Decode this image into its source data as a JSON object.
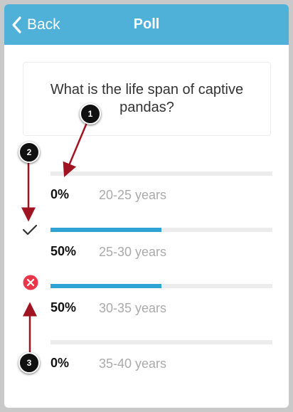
{
  "navbar": {
    "back_label": "Back",
    "title": "Poll",
    "color": "#4fb0d8"
  },
  "question": "What is the life span of captive pandas?",
  "options": [
    {
      "percent_label": "0%",
      "answer": "20-25 years",
      "fraction": 0.0,
      "state": "none"
    },
    {
      "percent_label": "50%",
      "answer": "25-30 years",
      "fraction": 0.5,
      "state": "correct",
      "icon": "checkmark-icon"
    },
    {
      "percent_label": "50%",
      "answer": "30-35 years",
      "fraction": 0.5,
      "state": "incorrect",
      "icon": "x-circle-icon"
    },
    {
      "percent_label": "0%",
      "answer": "35-40 years",
      "fraction": 0.0,
      "state": "none"
    }
  ],
  "callouts": [
    "1",
    "2",
    "3"
  ],
  "colors": {
    "bar_fill": "#2ea3d4",
    "incorrect": "#e8374a",
    "annotation_arrow": "#a01421"
  }
}
